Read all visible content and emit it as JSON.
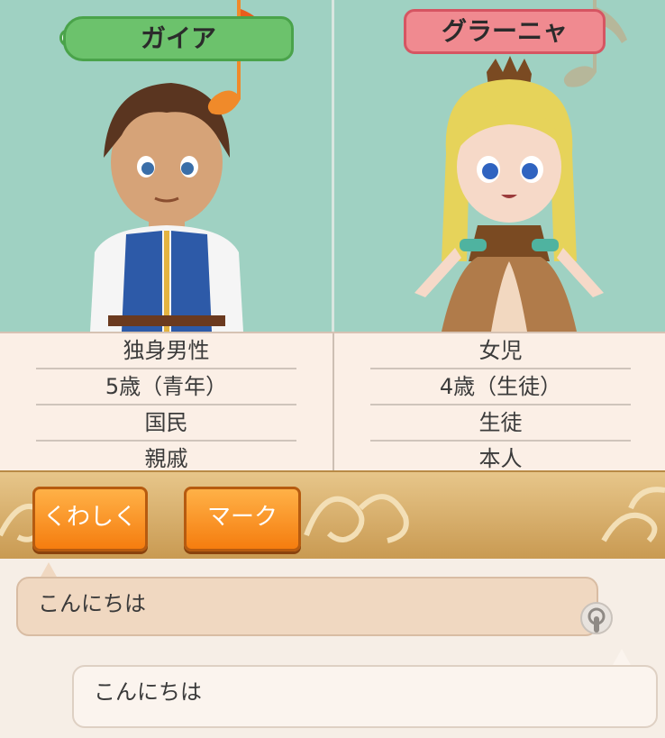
{
  "characters": {
    "left": {
      "name": "ガイア",
      "info": [
        "独身男性",
        "5歳（青年）",
        "国民",
        "親戚"
      ]
    },
    "right": {
      "name": "グラーニャ",
      "info": [
        "女児",
        "4歳（生徒）",
        "生徒",
        "本人"
      ]
    }
  },
  "toolbar": {
    "detail_label": "くわしく",
    "mark_label": "マーク"
  },
  "chat": {
    "messages": [
      {
        "side": "left",
        "text": "こんにちは"
      },
      {
        "side": "right",
        "text": "こんにちは"
      }
    ]
  },
  "colors": {
    "scene_background": "#9fd1c2",
    "left_tag": "#6cc26c",
    "right_tag": "#f08a90",
    "button": "#f57d0f",
    "toolbar": "#d9ae6a"
  },
  "icons": [
    "music-note-icon",
    "touch-icon"
  ]
}
